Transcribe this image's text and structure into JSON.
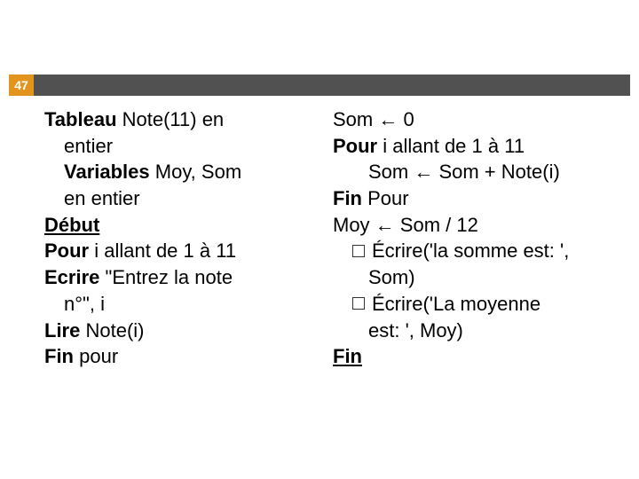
{
  "slideNumber": "47",
  "left": {
    "l1a": "Tableau",
    "l1b": " Note(11) en",
    "l2": "entier",
    "l3a": "Variables",
    "l3b": " Moy, Som",
    "l4": "en entier",
    "l5": "Début",
    "l6a": "Pour",
    "l6b": " i allant de 1 à 11",
    "l7a": "Ecrire",
    "l7b": " \"Entrez la note",
    "l8": "n°\", i",
    "l9a": "Lire",
    "l9b": " Note(i)",
    "l10a": "Fin",
    "l10b": " pour"
  },
  "right": {
    "r1": "Som ← 0",
    "r2a": "Pour",
    "r2b": " i allant de 1 à 11",
    "r3": "Som ← Som + Note(i)",
    "r4a": "Fin",
    "r4b": " Pour",
    "r5": "Moy ← Som / 12",
    "r6": "Écrire('la somme est: ',",
    "r6b": "Som)",
    "r7": "Écrire('La moyenne",
    "r7b": "est: ', Moy)",
    "r8": "Fin"
  }
}
